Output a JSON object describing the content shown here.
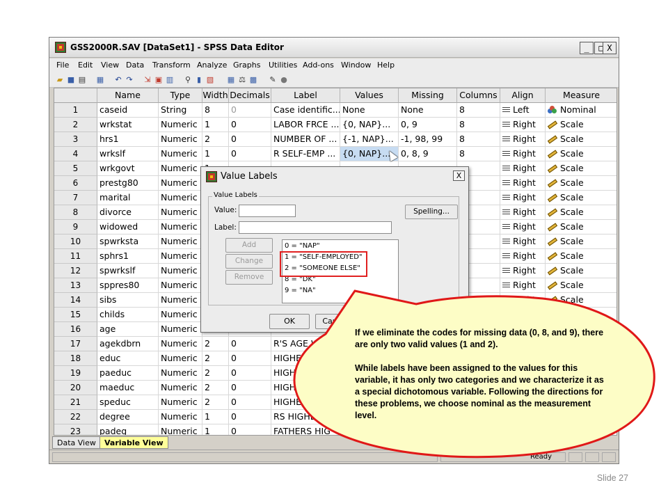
{
  "window": {
    "title": "GSS2000R.SAV [DataSet1] - SPSS Data Editor",
    "controls": [
      "_",
      "□",
      "X"
    ]
  },
  "menu": [
    "File",
    "Edit",
    "View",
    "Data",
    "Transform",
    "Analyze",
    "Graphs",
    "Utilities",
    "Add-ons",
    "Window",
    "Help"
  ],
  "toolbar": [
    "open-icon",
    "save-icon",
    "print-icon",
    "dialog-recall-icon",
    "undo-icon",
    "redo-icon",
    "goto-case-icon",
    "insert-cases-icon",
    "variables-icon",
    "find-icon",
    "insert-variable-icon",
    "split-file-icon",
    "weight-cases-icon",
    "select-cases-icon",
    "value-labels-icon",
    "use-sets-icon",
    "spell-icon"
  ],
  "grid": {
    "columns": [
      "Name",
      "Type",
      "Width",
      "Decimals",
      "Label",
      "Values",
      "Missing",
      "Columns",
      "Align",
      "Measure"
    ],
    "rows": [
      {
        "num": "1",
        "name": "caseid",
        "type": "String",
        "width": "8",
        "decimals": "0",
        "label": "Case identific...",
        "values": "None",
        "missing": "None",
        "columns": "8",
        "align": "Left",
        "measure": "Nominal"
      },
      {
        "num": "2",
        "name": "wrkstat",
        "type": "Numeric",
        "width": "1",
        "decimals": "0",
        "label": "LABOR FRCE ...",
        "values": "{0, NAP}...",
        "missing": "0, 9",
        "columns": "8",
        "align": "Right",
        "measure": "Scale"
      },
      {
        "num": "3",
        "name": "hrs1",
        "type": "Numeric",
        "width": "2",
        "decimals": "0",
        "label": "NUMBER OF ...",
        "values": "{-1, NAP}...",
        "missing": "-1, 98, 99",
        "columns": "8",
        "align": "Right",
        "measure": "Scale"
      },
      {
        "num": "4",
        "name": "wrkslf",
        "type": "Numeric",
        "width": "1",
        "decimals": "0",
        "label": "R SELF-EMP ...",
        "values": "{0, NAP}...",
        "missing": "0, 8, 9",
        "columns": "8",
        "align": "Right",
        "measure": "Scale"
      },
      {
        "num": "5",
        "name": "wrkgovt",
        "type": "Numeric",
        "width": "1",
        "decimals": "",
        "label": "",
        "values": "",
        "missing": "",
        "columns": "",
        "align": "Right",
        "measure": "Scale"
      },
      {
        "num": "6",
        "name": "prestg80",
        "type": "Numeric",
        "width": "2",
        "decimals": "",
        "label": "",
        "values": "",
        "missing": "",
        "columns": "",
        "align": "Right",
        "measure": "Scale"
      },
      {
        "num": "7",
        "name": "marital",
        "type": "Numeric",
        "width": "1",
        "decimals": "",
        "label": "",
        "values": "",
        "missing": "",
        "columns": "",
        "align": "Right",
        "measure": "Scale"
      },
      {
        "num": "8",
        "name": "divorce",
        "type": "Numeric",
        "width": "1",
        "decimals": "",
        "label": "",
        "values": "",
        "missing": "",
        "columns": "",
        "align": "Right",
        "measure": "Scale"
      },
      {
        "num": "9",
        "name": "widowed",
        "type": "Numeric",
        "width": "1",
        "decimals": "",
        "label": "",
        "values": "",
        "missing": "",
        "columns": "",
        "align": "Right",
        "measure": "Scale"
      },
      {
        "num": "10",
        "name": "spwrksta",
        "type": "Numeric",
        "width": "1",
        "decimals": "",
        "label": "",
        "values": "",
        "missing": "",
        "columns": "",
        "align": "Right",
        "measure": "Scale"
      },
      {
        "num": "11",
        "name": "sphrs1",
        "type": "Numeric",
        "width": "2",
        "decimals": "",
        "label": "",
        "values": "",
        "missing": "",
        "columns": "",
        "align": "Right",
        "measure": "Scale"
      },
      {
        "num": "12",
        "name": "spwrkslf",
        "type": "Numeric",
        "width": "1",
        "decimals": "",
        "label": "",
        "values": "",
        "missing": "",
        "columns": "",
        "align": "Right",
        "measure": "Scale"
      },
      {
        "num": "13",
        "name": "sppres80",
        "type": "Numeric",
        "width": "2",
        "decimals": "",
        "label": "",
        "values": "",
        "missing": "",
        "columns": "",
        "align": "Right",
        "measure": "Scale"
      },
      {
        "num": "14",
        "name": "sibs",
        "type": "Numeric",
        "width": "2",
        "decimals": "",
        "label": "",
        "values": "",
        "missing": "",
        "columns": "",
        "align": "Right",
        "measure": "Scale"
      },
      {
        "num": "15",
        "name": "childs",
        "type": "Numeric",
        "width": "1",
        "decimals": "",
        "label": "",
        "values": "",
        "missing": "",
        "columns": "",
        "align": "",
        "measure": ""
      },
      {
        "num": "16",
        "name": "age",
        "type": "Numeric",
        "width": "2",
        "decimals": "",
        "label": "",
        "values": "",
        "missing": "",
        "columns": "",
        "align": "",
        "measure": ""
      },
      {
        "num": "17",
        "name": "agekdbrn",
        "type": "Numeric",
        "width": "2",
        "decimals": "0",
        "label": "R'S AGE W",
        "values": "",
        "missing": "",
        "columns": "",
        "align": "",
        "measure": ""
      },
      {
        "num": "18",
        "name": "educ",
        "type": "Numeric",
        "width": "2",
        "decimals": "0",
        "label": "HIGHES",
        "values": "",
        "missing": "",
        "columns": "",
        "align": "",
        "measure": ""
      },
      {
        "num": "19",
        "name": "paeduc",
        "type": "Numeric",
        "width": "2",
        "decimals": "0",
        "label": "HIGHE",
        "values": "",
        "missing": "",
        "columns": "",
        "align": "",
        "measure": ""
      },
      {
        "num": "20",
        "name": "maeduc",
        "type": "Numeric",
        "width": "2",
        "decimals": "0",
        "label": "HIGHE",
        "values": "",
        "missing": "",
        "columns": "",
        "align": "",
        "measure": ""
      },
      {
        "num": "21",
        "name": "speduc",
        "type": "Numeric",
        "width": "2",
        "decimals": "0",
        "label": "HIGHES",
        "values": "",
        "missing": "",
        "columns": "",
        "align": "",
        "measure": ""
      },
      {
        "num": "22",
        "name": "degree",
        "type": "Numeric",
        "width": "1",
        "decimals": "0",
        "label": "RS HIGHE",
        "values": "",
        "missing": "",
        "columns": "",
        "align": "",
        "measure": ""
      },
      {
        "num": "23",
        "name": "padeg",
        "type": "Numeric",
        "width": "1",
        "decimals": "0",
        "label": "FATHERS HIG",
        "values": "",
        "missing": "",
        "columns": "",
        "align": "",
        "measure": ""
      }
    ]
  },
  "tabs": [
    "Data View",
    "Variable View"
  ],
  "active_tab": "Variable View",
  "status": "Ready",
  "dialog": {
    "title": "Value Labels",
    "close": "X",
    "group_label": "Value Labels",
    "value_label": "Value:",
    "label_label": "Label:",
    "value_input": "",
    "label_input": "",
    "buttons": {
      "add": "Add",
      "change": "Change",
      "remove": "Remove",
      "spelling": "Spelling...",
      "ok": "OK",
      "cancel": "Cancel"
    },
    "list": [
      "0 = \"NAP\"",
      "1 = \"SELF-EMPLOYED\"",
      "2 = \"SOMEONE ELSE\"",
      "8 = \"DK\"",
      "9 = \"NA\""
    ]
  },
  "callout": {
    "paragraph1": "If we eliminate the codes for missing data (0, 8, and 9), there are only two valid values (1 and 2).",
    "paragraph2": "While labels have been assigned to the values for this variable, it has only two categories and we characterize it as a special dichotomous variable. Following the directions for these problems, we choose nominal as the measurement level.",
    "fill_color": "#fdfdc6",
    "border_color": "#e01818"
  },
  "slide_number": "Slide 27",
  "colors": {
    "selected_cell": "#c7dcf2",
    "highlight_box": "#e02020",
    "active_tab": "#ffff99"
  }
}
